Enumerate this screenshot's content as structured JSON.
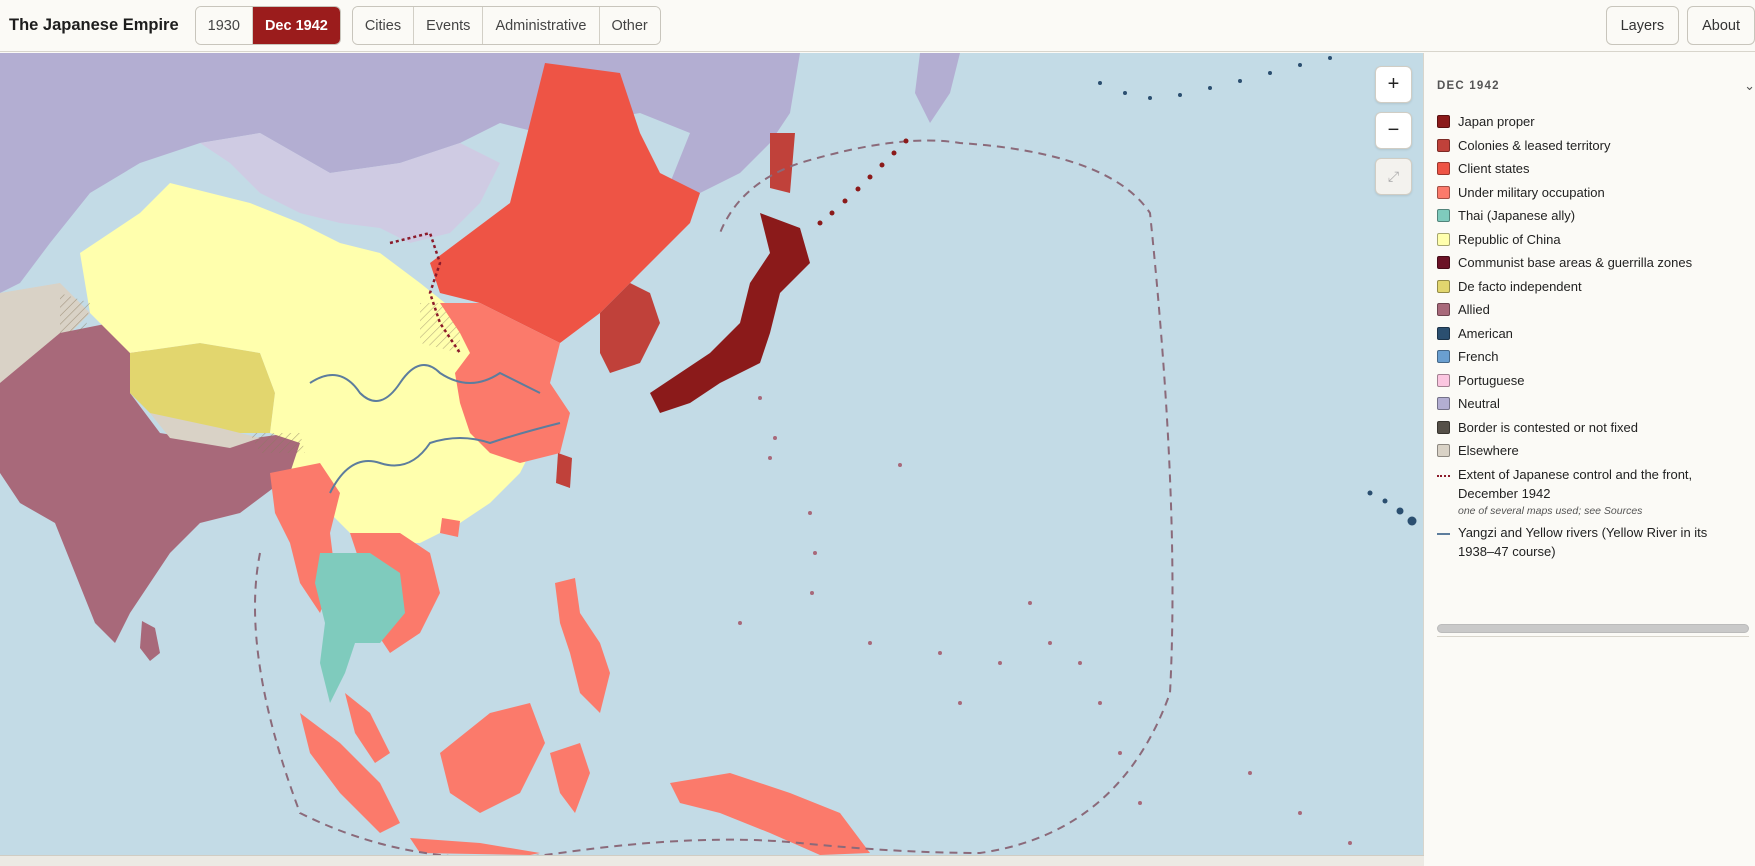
{
  "app": {
    "title": "The Japanese Empire"
  },
  "timeline": {
    "options": [
      "1930",
      "Dec 1942"
    ],
    "active_index": 1
  },
  "categories": [
    "Cities",
    "Events",
    "Administrative",
    "Other"
  ],
  "top_right": {
    "layers": "Layers",
    "about": "About"
  },
  "zoom": {
    "in": "+",
    "out": "−",
    "fit": "⤢"
  },
  "panel": {
    "title": "DEC 1942",
    "legend": [
      {
        "label": "Japan proper",
        "color": "#8b1a1a",
        "kind": "fill"
      },
      {
        "label": "Colonies & leased territory",
        "color": "#c0413a",
        "kind": "fill"
      },
      {
        "label": "Client states",
        "color": "#ee5445",
        "kind": "fill"
      },
      {
        "label": "Under military occupation",
        "color": "#fb7a6b",
        "kind": "fill"
      },
      {
        "label": "Thai (Japanese ally)",
        "color": "#7fcbbd",
        "kind": "fill"
      },
      {
        "label": "Republic of China",
        "color": "#ffffad",
        "kind": "fill"
      },
      {
        "label": "Communist base areas & guerrilla zones",
        "color": "#6b1226",
        "kind": "fill"
      },
      {
        "label": "De facto independent",
        "color": "#e2d66e",
        "kind": "fill"
      },
      {
        "label": "Allied",
        "color": "#a8697a",
        "kind": "fill"
      },
      {
        "label": "American",
        "color": "#2b4f70",
        "kind": "fill"
      },
      {
        "label": "French",
        "color": "#6a9fd0",
        "kind": "fill"
      },
      {
        "label": "Portuguese",
        "color": "#fbc6e0",
        "kind": "fill"
      },
      {
        "label": "Neutral",
        "color": "#b3aed2",
        "kind": "fill"
      },
      {
        "label": "Border is contested or not fixed",
        "color": "#555048",
        "kind": "fill"
      },
      {
        "label": "Elsewhere",
        "color": "#d9d2c6",
        "kind": "fill"
      },
      {
        "label": "Extent of Japanese control and the front, December 1942",
        "color": "#8b1a2a",
        "kind": "dotted",
        "note": "one of several maps used; see Sources"
      },
      {
        "label": "Yangzi and Yellow rivers (Yellow River in its 1938–47 course)",
        "color": "#5d7d9d",
        "kind": "line"
      }
    ]
  }
}
